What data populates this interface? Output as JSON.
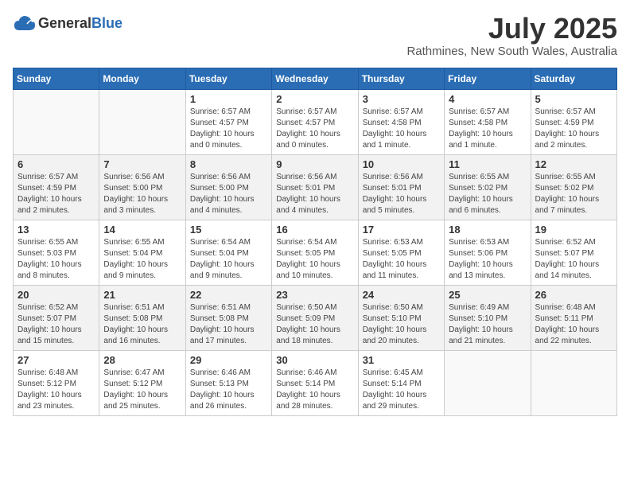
{
  "logo": {
    "general": "General",
    "blue": "Blue"
  },
  "title": "July 2025",
  "subtitle": "Rathmines, New South Wales, Australia",
  "weekdays": [
    "Sunday",
    "Monday",
    "Tuesday",
    "Wednesday",
    "Thursday",
    "Friday",
    "Saturday"
  ],
  "weeks": [
    [
      {
        "day": "",
        "info": ""
      },
      {
        "day": "",
        "info": ""
      },
      {
        "day": "1",
        "info": "Sunrise: 6:57 AM\nSunset: 4:57 PM\nDaylight: 10 hours\nand 0 minutes."
      },
      {
        "day": "2",
        "info": "Sunrise: 6:57 AM\nSunset: 4:57 PM\nDaylight: 10 hours\nand 0 minutes."
      },
      {
        "day": "3",
        "info": "Sunrise: 6:57 AM\nSunset: 4:58 PM\nDaylight: 10 hours\nand 1 minute."
      },
      {
        "day": "4",
        "info": "Sunrise: 6:57 AM\nSunset: 4:58 PM\nDaylight: 10 hours\nand 1 minute."
      },
      {
        "day": "5",
        "info": "Sunrise: 6:57 AM\nSunset: 4:59 PM\nDaylight: 10 hours\nand 2 minutes."
      }
    ],
    [
      {
        "day": "6",
        "info": "Sunrise: 6:57 AM\nSunset: 4:59 PM\nDaylight: 10 hours\nand 2 minutes."
      },
      {
        "day": "7",
        "info": "Sunrise: 6:56 AM\nSunset: 5:00 PM\nDaylight: 10 hours\nand 3 minutes."
      },
      {
        "day": "8",
        "info": "Sunrise: 6:56 AM\nSunset: 5:00 PM\nDaylight: 10 hours\nand 4 minutes."
      },
      {
        "day": "9",
        "info": "Sunrise: 6:56 AM\nSunset: 5:01 PM\nDaylight: 10 hours\nand 4 minutes."
      },
      {
        "day": "10",
        "info": "Sunrise: 6:56 AM\nSunset: 5:01 PM\nDaylight: 10 hours\nand 5 minutes."
      },
      {
        "day": "11",
        "info": "Sunrise: 6:55 AM\nSunset: 5:02 PM\nDaylight: 10 hours\nand 6 minutes."
      },
      {
        "day": "12",
        "info": "Sunrise: 6:55 AM\nSunset: 5:02 PM\nDaylight: 10 hours\nand 7 minutes."
      }
    ],
    [
      {
        "day": "13",
        "info": "Sunrise: 6:55 AM\nSunset: 5:03 PM\nDaylight: 10 hours\nand 8 minutes."
      },
      {
        "day": "14",
        "info": "Sunrise: 6:55 AM\nSunset: 5:04 PM\nDaylight: 10 hours\nand 9 minutes."
      },
      {
        "day": "15",
        "info": "Sunrise: 6:54 AM\nSunset: 5:04 PM\nDaylight: 10 hours\nand 9 minutes."
      },
      {
        "day": "16",
        "info": "Sunrise: 6:54 AM\nSunset: 5:05 PM\nDaylight: 10 hours\nand 10 minutes."
      },
      {
        "day": "17",
        "info": "Sunrise: 6:53 AM\nSunset: 5:05 PM\nDaylight: 10 hours\nand 11 minutes."
      },
      {
        "day": "18",
        "info": "Sunrise: 6:53 AM\nSunset: 5:06 PM\nDaylight: 10 hours\nand 13 minutes."
      },
      {
        "day": "19",
        "info": "Sunrise: 6:52 AM\nSunset: 5:07 PM\nDaylight: 10 hours\nand 14 minutes."
      }
    ],
    [
      {
        "day": "20",
        "info": "Sunrise: 6:52 AM\nSunset: 5:07 PM\nDaylight: 10 hours\nand 15 minutes."
      },
      {
        "day": "21",
        "info": "Sunrise: 6:51 AM\nSunset: 5:08 PM\nDaylight: 10 hours\nand 16 minutes."
      },
      {
        "day": "22",
        "info": "Sunrise: 6:51 AM\nSunset: 5:08 PM\nDaylight: 10 hours\nand 17 minutes."
      },
      {
        "day": "23",
        "info": "Sunrise: 6:50 AM\nSunset: 5:09 PM\nDaylight: 10 hours\nand 18 minutes."
      },
      {
        "day": "24",
        "info": "Sunrise: 6:50 AM\nSunset: 5:10 PM\nDaylight: 10 hours\nand 20 minutes."
      },
      {
        "day": "25",
        "info": "Sunrise: 6:49 AM\nSunset: 5:10 PM\nDaylight: 10 hours\nand 21 minutes."
      },
      {
        "day": "26",
        "info": "Sunrise: 6:48 AM\nSunset: 5:11 PM\nDaylight: 10 hours\nand 22 minutes."
      }
    ],
    [
      {
        "day": "27",
        "info": "Sunrise: 6:48 AM\nSunset: 5:12 PM\nDaylight: 10 hours\nand 23 minutes."
      },
      {
        "day": "28",
        "info": "Sunrise: 6:47 AM\nSunset: 5:12 PM\nDaylight: 10 hours\nand 25 minutes."
      },
      {
        "day": "29",
        "info": "Sunrise: 6:46 AM\nSunset: 5:13 PM\nDaylight: 10 hours\nand 26 minutes."
      },
      {
        "day": "30",
        "info": "Sunrise: 6:46 AM\nSunset: 5:14 PM\nDaylight: 10 hours\nand 28 minutes."
      },
      {
        "day": "31",
        "info": "Sunrise: 6:45 AM\nSunset: 5:14 PM\nDaylight: 10 hours\nand 29 minutes."
      },
      {
        "day": "",
        "info": ""
      },
      {
        "day": "",
        "info": ""
      }
    ]
  ]
}
